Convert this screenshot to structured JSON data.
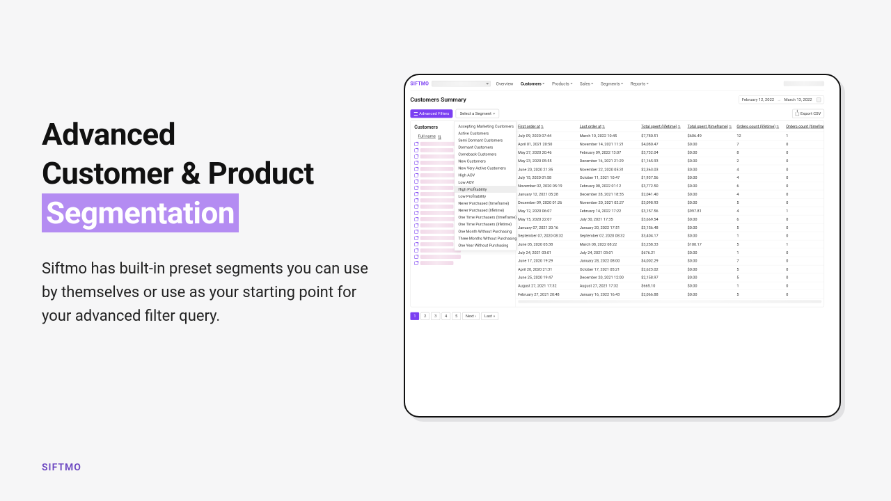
{
  "marketing": {
    "headline_line1": "Advanced",
    "headline_line2": "Customer & Product",
    "headline_line3": "Segmentation",
    "body": "Siftmo has built-in preset segments you can use by themselves or use as your starting point for your advanced filter query.",
    "footer_brand": "SIFTMO"
  },
  "app": {
    "brand": "SIFTMO",
    "nav": {
      "overview": "Overview",
      "customers": "Customers",
      "products": "Products",
      "sales": "Sales",
      "segments": "Segments",
      "reports": "Reports"
    },
    "date_range": {
      "from": "February 12, 2022",
      "sep": "→",
      "to": "March 13, 2022"
    },
    "page_title": "Customers Summary",
    "buttons": {
      "advanced_filters": "Advanced Filters",
      "select_segment": "Select a Segment",
      "export_csv": "Export CSV"
    },
    "left_header": "Customers",
    "col_fullname": "Full name",
    "segments_list": [
      "Accepting Marketing Customers",
      "Active Customers",
      "Semi Dormant Customers",
      "Dormant Customers",
      "Comeback Customers",
      "New Customers",
      "New Very Active Customers",
      "High AOV",
      "Low AOV",
      "High Profitability",
      "Low Profitability",
      "Never Purchased (timeframe)",
      "Never Purchased (lifetime)",
      "One Time Purchasers (timeframe)",
      "One Time Purchasers (lifetime)",
      "One Month Without Purchasing",
      "Three Months Without Purchasing",
      "One Year Without Purchasing"
    ],
    "segments_hover_index": 9,
    "columns": {
      "first_order": "First order at",
      "last_order": "Last order at",
      "total_spent_life": "Total spent (lifetime)",
      "total_spent_tf": "Total spent (timeframe)",
      "orders_life": "Orders count (lifetime)",
      "orders_tf": "Orders count (timeframe)"
    },
    "rows": [
      {
        "first": "July 09, 2020 07:44",
        "last": "March 10, 2022 10:45",
        "lspent": "$7,780.51",
        "tspent": "$606.49",
        "loc": "12",
        "toc": "1"
      },
      {
        "first": "April 01, 2021 20:50",
        "last": "November 14, 2021 11:21",
        "lspent": "$4,080.47",
        "tspent": "$0.00",
        "loc": "7",
        "toc": "0"
      },
      {
        "first": "May 27, 2020 20:46",
        "last": "February 09, 2022 13:07",
        "lspent": "$3,732.04",
        "tspent": "$0.00",
        "loc": "8",
        "toc": "0"
      },
      {
        "first": "May 23, 2020 05:55",
        "last": "December 16, 2021 21:29",
        "lspent": "$1,165.93",
        "tspent": "$0.00",
        "loc": "2",
        "toc": "0"
      },
      {
        "first": "June 20, 2020 21:35",
        "last": "November 22, 2020 05:31",
        "lspent": "$2,363.03",
        "tspent": "$0.00",
        "loc": "4",
        "toc": "0"
      },
      {
        "first": "July 15, 2020 01:58",
        "last": "October 11, 2021 10:47",
        "lspent": "$1,937.56",
        "tspent": "$0.00",
        "loc": "4",
        "toc": "0"
      },
      {
        "first": "November 02, 2020 05:19",
        "last": "February 08, 2022 01:12",
        "lspent": "$3,772.50",
        "tspent": "$0.00",
        "loc": "6",
        "toc": "0"
      },
      {
        "first": "January 12, 2021 05:28",
        "last": "December 28, 2021 18:35",
        "lspent": "$2,041.40",
        "tspent": "$0.00",
        "loc": "4",
        "toc": "0"
      },
      {
        "first": "December 09, 2020 01:26",
        "last": "November 20, 2021 02:27",
        "lspent": "$3,098.93",
        "tspent": "$0.00",
        "loc": "5",
        "toc": "0"
      },
      {
        "first": "May 12, 2020 06:07",
        "last": "February 14, 2022 17:22",
        "lspent": "$3,157.56",
        "tspent": "$997.81",
        "loc": "4",
        "toc": "1"
      },
      {
        "first": "May 15, 2020 22:07",
        "last": "July 30, 2021 17:35",
        "lspent": "$3,669.54",
        "tspent": "$0.00",
        "loc": "6",
        "toc": "0"
      },
      {
        "first": "January 07, 2021 20:16",
        "last": "January 20, 2022 17:51",
        "lspent": "$3,156.48",
        "tspent": "$0.00",
        "loc": "5",
        "toc": "0"
      },
      {
        "first": "September 07, 2020 08:32",
        "last": "September 07, 2020 08:32",
        "lspent": "$3,404.17",
        "tspent": "$0.00",
        "loc": "1",
        "toc": "0"
      },
      {
        "first": "June 05, 2020 05:38",
        "last": "March 08, 2022 08:22",
        "lspent": "$3,258.33",
        "tspent": "$100.17",
        "loc": "5",
        "toc": "1"
      },
      {
        "first": "July 24, 2021 03:01",
        "last": "July 24, 2021 03:01",
        "lspent": "$676.21",
        "tspent": "$0.00",
        "loc": "1",
        "toc": "0"
      },
      {
        "first": "June 17, 2020 19:29",
        "last": "January 28, 2022 08:00",
        "lspent": "$4,002.29",
        "tspent": "$0.00",
        "loc": "7",
        "toc": "0"
      },
      {
        "first": "April 20, 2020 21:31",
        "last": "October 17, 2021 05:21",
        "lspent": "$2,623.02",
        "tspent": "$0.00",
        "loc": "5",
        "toc": "0"
      },
      {
        "first": "June 25, 2020 19:47",
        "last": "December 20, 2021 12:00",
        "lspent": "$2,158.97",
        "tspent": "$0.00",
        "loc": "5",
        "toc": "0"
      },
      {
        "first": "August 27, 2021 17:32",
        "last": "August 27, 2021 17:32",
        "lspent": "$665.10",
        "tspent": "$0.00",
        "loc": "1",
        "toc": "0"
      },
      {
        "first": "February 27, 2021 20:48",
        "last": "January 16, 2022 16:43",
        "lspent": "$2,066.88",
        "tspent": "$0.00",
        "loc": "5",
        "toc": "0"
      }
    ],
    "pager": {
      "pages": [
        "1",
        "2",
        "3",
        "4",
        "5"
      ],
      "next": "Next ›",
      "last": "Last »",
      "active_index": 0
    }
  }
}
